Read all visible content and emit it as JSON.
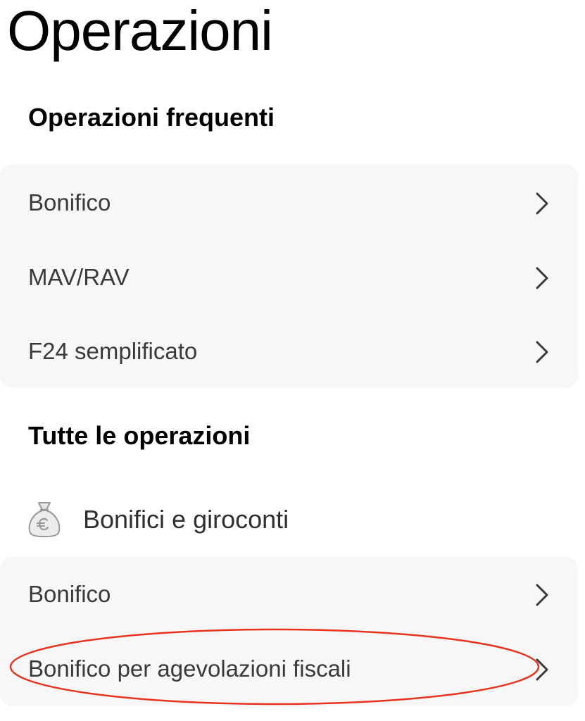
{
  "page": {
    "title": "Operazioni"
  },
  "frequent": {
    "title": "Operazioni frequenti",
    "items": [
      {
        "label": "Bonifico"
      },
      {
        "label": "MAV/RAV"
      },
      {
        "label": "F24 semplificato"
      }
    ]
  },
  "all": {
    "title": "Tutte le operazioni",
    "groups": [
      {
        "label": "Bonifici e giroconti",
        "icon": "money-bag-euro-icon",
        "items": [
          {
            "label": "Bonifico"
          },
          {
            "label": "Bonifico per agevolazioni fiscali",
            "highlighted": true
          }
        ]
      }
    ]
  },
  "colors": {
    "card_background": "#f7f7f7",
    "highlight": "#e8331f",
    "chevron": "#3a3a3a"
  }
}
